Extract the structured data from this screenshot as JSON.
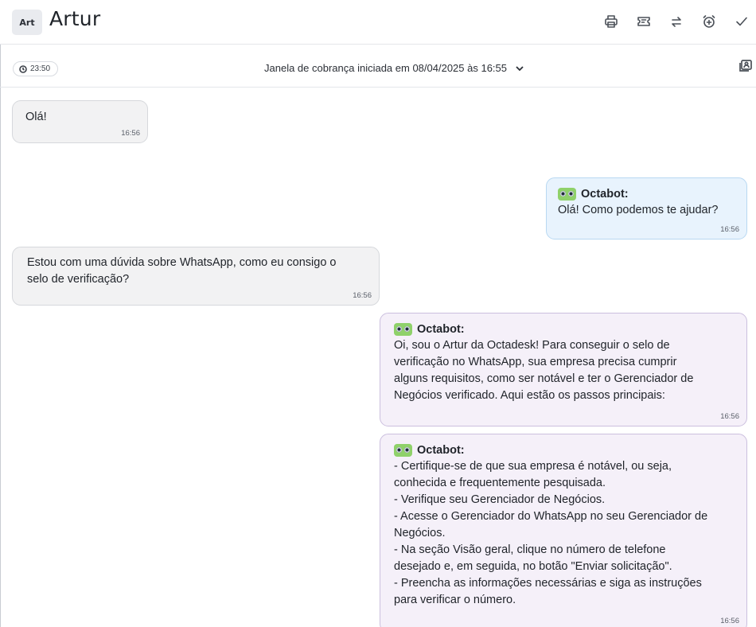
{
  "header": {
    "avatar_text": "Art",
    "contact_name": "Artur",
    "icons": [
      "printer-icon",
      "ticket-icon",
      "transfer-icon",
      "alarm-icon",
      "check-icon"
    ]
  },
  "billing": {
    "timer": "23:50",
    "text": "Janela de cobrança iniciada em 08/04/2025 às 16:55"
  },
  "messages": [
    {
      "direction": "in",
      "text": "Olá!",
      "time": "16:56"
    },
    {
      "direction": "out",
      "sender": "Octabot:",
      "text": "Olá! Como podemos te ajudar?",
      "time": "16:56"
    },
    {
      "direction": "in",
      "text": "Estou com uma dúvida sobre WhatsApp, como eu consigo o\nselo de verificação?",
      "time": "16:56"
    },
    {
      "direction": "out",
      "sender": "Octabot:",
      "text": "Oi, sou o Artur da Octadesk! Para conseguir o selo de\nverificação no WhatsApp, sua empresa precisa cumprir\nalguns requisitos, como ser notável e ter o Gerenciador de\nNegócios verificado. Aqui estão os passos principais:",
      "time": "16:56"
    },
    {
      "direction": "out",
      "sender": "Octabot:",
      "text": "- Certifique-se de que sua empresa é notável, ou seja,\nconhecida e frequentemente pesquisada.\n- Verifique seu Gerenciador de Negócios.\n- Acesse o Gerenciador do WhatsApp no seu Gerenciador de\nNegócios.\n- Na seção Visão geral, clique no número de telefone\ndesejado e, em seguida, no botão \"Enviar solicitação\".\n- Preencha as informações necessárias e siga as instruções\npara verificar o número.",
      "time": "16:56"
    }
  ]
}
